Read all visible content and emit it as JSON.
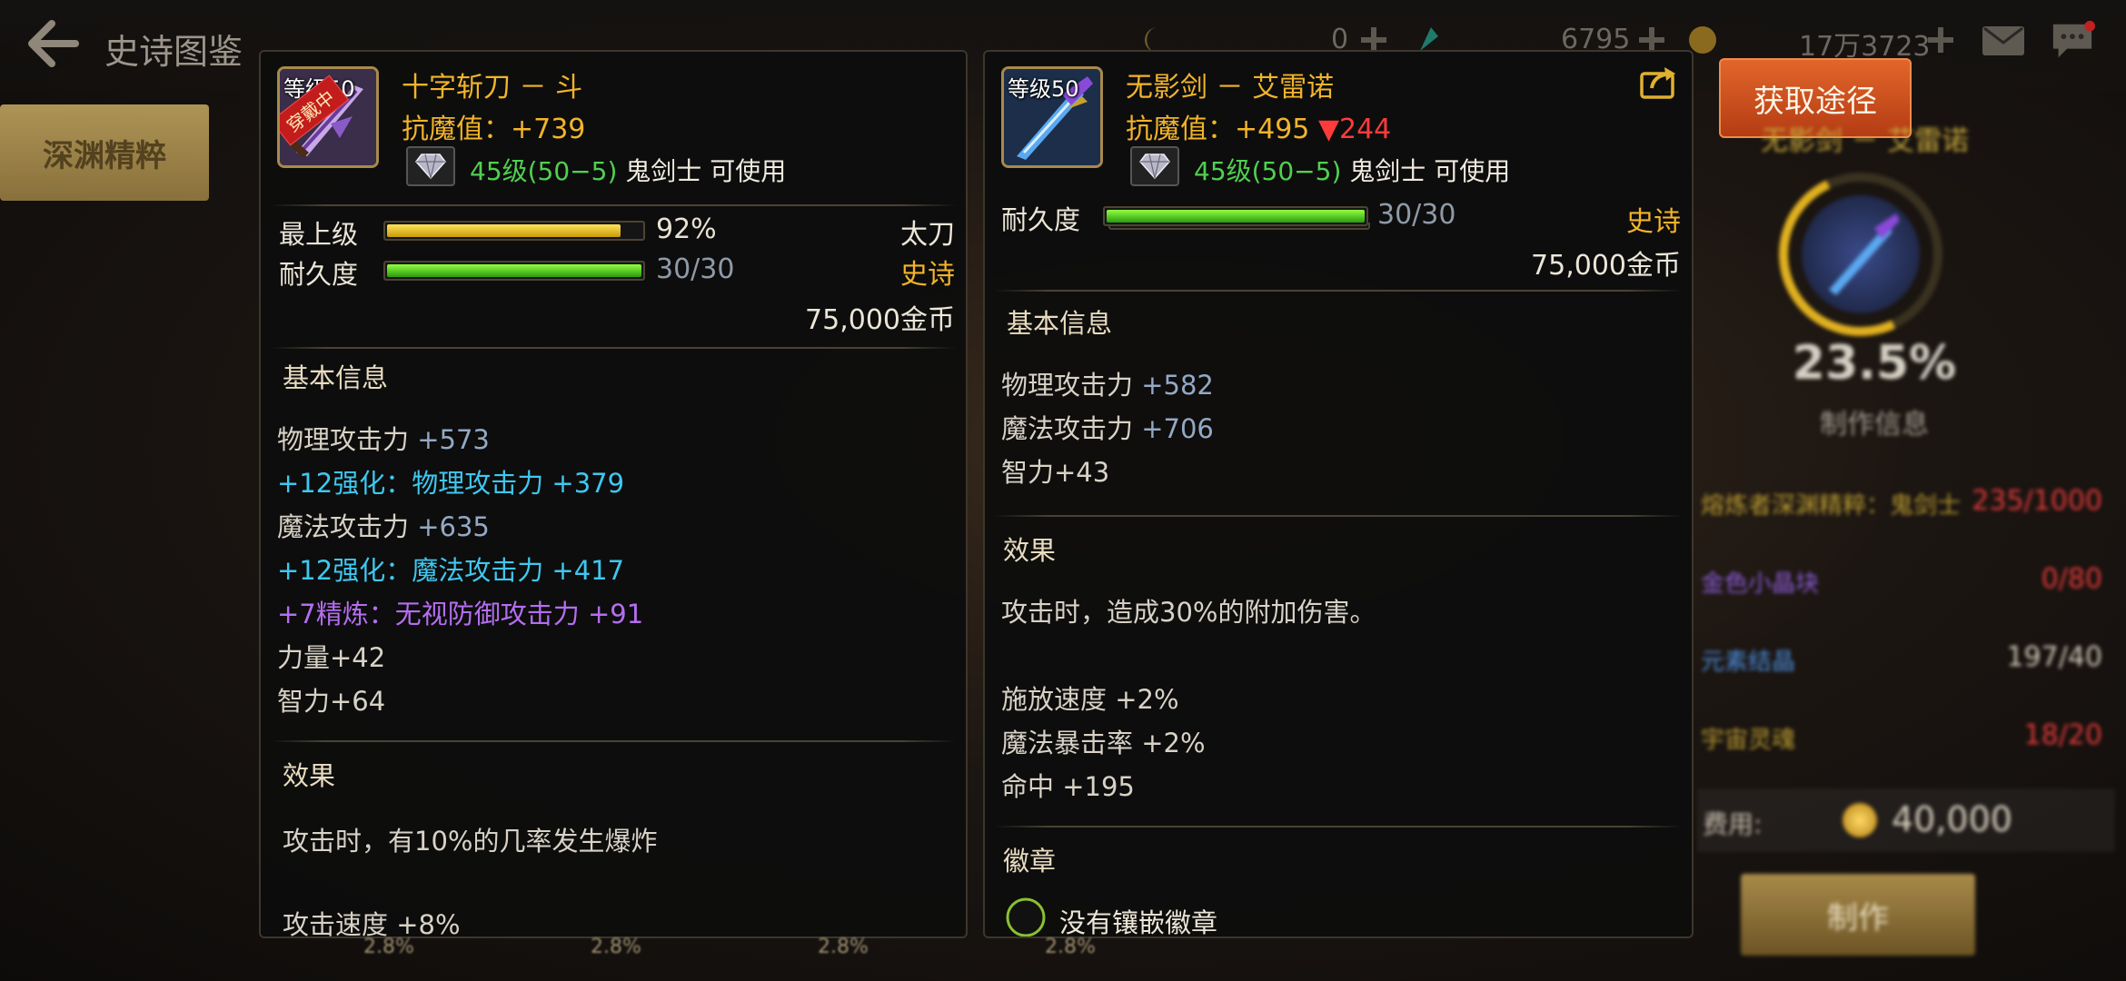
{
  "topbar": {
    "title": "史诗图鉴",
    "res1": "0",
    "res2": "6795",
    "gold": "17万3723"
  },
  "category": {
    "active_label": "深渊精粹"
  },
  "item_a": {
    "level_tag": "等级50",
    "equipped_tag": "穿戴中",
    "name": "十字斩刀 － 斗",
    "magic_res": "抗魔值：+739",
    "usable_level": "45级(50−5)",
    "usable_class": " 鬼剑士 可使用",
    "grade_label": "最上级",
    "grade_value": "92%",
    "grade_pct": 92,
    "durability_label": "耐久度",
    "durability_value": "30/30",
    "durability_pct": 100,
    "weapon_type": "太刀",
    "rarity": "史诗",
    "price": "75,000金币",
    "basic_title": "基本信息",
    "stat_phys_label": "物理攻击力 ",
    "stat_phys_val": "+573",
    "stat_phys_enh": "+12强化：物理攻击力 +379",
    "stat_mag_label": "魔法攻击力 ",
    "stat_mag_val": "+635",
    "stat_mag_enh": "+12强化：魔法攻击力 +417",
    "stat_refine": "+7精炼：无视防御攻击力 +91",
    "stat_str": "力量+42",
    "stat_int": "智力+64",
    "effect_title": "效果",
    "effect_text": "攻击时，有10%的几率发生爆炸",
    "effect_cut": "攻击速度 +8%"
  },
  "item_b": {
    "level_tag": "等级50",
    "name": "无影剑 － 艾雷诺",
    "magic_res_prefix": "抗魔值：+495 ",
    "magic_res_diff": "▼244",
    "usable_level": "45级(50−5)",
    "usable_class": " 鬼剑士 可使用",
    "durability_label": "耐久度",
    "durability_value": "30/30",
    "durability_pct": 100,
    "rarity": "史诗",
    "price": "75,000金币",
    "basic_title": "基本信息",
    "stat_phys_label": "物理攻击力 ",
    "stat_phys_val": "+582",
    "stat_mag_label": "魔法攻击力 ",
    "stat_mag_val": "+706",
    "stat_int": "智力+43",
    "effect_title": "效果",
    "effect_text": "攻击时，造成30%的附加伤害。",
    "stat_cast": "施放速度 +2%",
    "stat_crit": "魔法暴击率 +2%",
    "stat_hit": "命中 +195",
    "emblem_title": "徽章",
    "emblem_text": "没有镶嵌徽章"
  },
  "side": {
    "get_button": "获取途径",
    "item_name": "无影剑 － 艾雷诺",
    "progress": "23.5%",
    "progress_pct": 23.5,
    "craft_info": "制作信息",
    "materials": [
      {
        "name": "熔炼者深渊精粹：鬼剑士",
        "qty": "235/1000"
      },
      {
        "name": "金色小晶块",
        "qty": "0/80"
      },
      {
        "name": "元素结晶",
        "qty": "197/40"
      },
      {
        "name": "宇宙灵魂",
        "qty": "18/20"
      }
    ],
    "fee_label": "费用:",
    "fee_value": "40,000",
    "make_button": "制作"
  },
  "bottom": {
    "c1": "2.8%",
    "c2": "2.8%",
    "c3": "2.8%",
    "c4": "2.8%"
  },
  "colors": {
    "epic": "#f2b42a",
    "enhance": "#3ec8f0",
    "refine": "#b46ef0",
    "usable_level": "#4fd04f",
    "downgrade": "#ff3b3b"
  }
}
